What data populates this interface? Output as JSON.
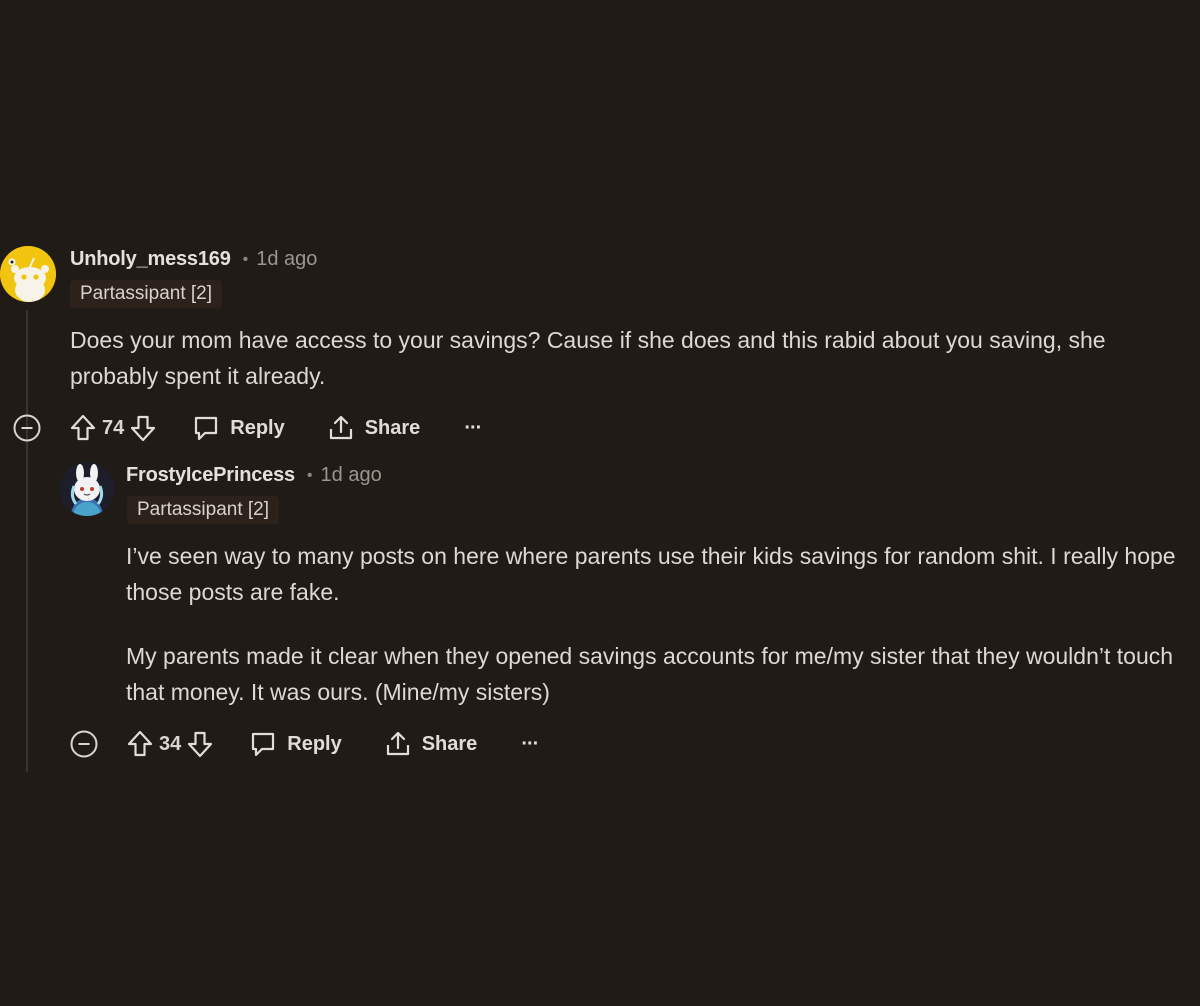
{
  "comments": [
    {
      "username": "Unholy_mess169",
      "separator": "•",
      "time": "1d ago",
      "flair": "Partassipant [2]",
      "body": [
        "Does your mom have access to your savings? Cause if she does and this rabid about you saving, she probably spent it already."
      ],
      "votes": "74",
      "reply_label": "Reply",
      "share_label": "Share",
      "more_label": "···"
    },
    {
      "username": "FrostyIcePrincess",
      "separator": "•",
      "time": "1d ago",
      "flair": "Partassipant [2]",
      "body": [
        "I’ve seen way to many posts on here where parents use their kids savings for random shit. I really hope those posts are fake.",
        "My parents made it clear when they opened savings accounts for me/my sister that they wouldn’t touch that money. It was ours. (Mine/my sisters)"
      ],
      "votes": "34",
      "reply_label": "Reply",
      "share_label": "Share",
      "more_label": "···"
    }
  ],
  "icons": {
    "collapse": "collapse-icon",
    "upvote": "upvote-arrow-icon",
    "downvote": "downvote-arrow-icon",
    "reply": "comment-bubble-icon",
    "share": "share-upload-icon",
    "more": "ellipsis-icon"
  },
  "colors": {
    "background": "#201b17",
    "text": "#dcd9d5",
    "flair_bg": "#2d211c",
    "avatar_yellow": "#f1c40f"
  }
}
